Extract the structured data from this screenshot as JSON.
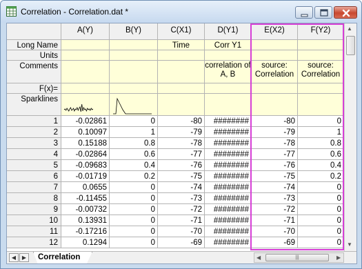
{
  "window": {
    "title": "Correlation - Correlation.dat *"
  },
  "columns": [
    {
      "header": "A(Y)",
      "long_name": "",
      "units": "",
      "comments": "",
      "fx": "",
      "sparkline": "noise"
    },
    {
      "header": "B(Y)",
      "long_name": "",
      "units": "",
      "comments": "",
      "fx": "",
      "sparkline": "decay"
    },
    {
      "header": "C(X1)",
      "long_name": "Time",
      "units": "",
      "comments": "",
      "fx": "",
      "sparkline": ""
    },
    {
      "header": "D(Y1)",
      "long_name": "Corr Y1",
      "units": "",
      "comments": "correlation of A, B",
      "fx": "",
      "sparkline": ""
    },
    {
      "header": "E(X2)",
      "long_name": "",
      "units": "",
      "comments": "source: Correlation",
      "fx": "",
      "sparkline": ""
    },
    {
      "header": "F(Y2)",
      "long_name": "",
      "units": "",
      "comments": "source: Correlation",
      "fx": "",
      "sparkline": ""
    }
  ],
  "row_labels": {
    "long_name": "Long Name",
    "units": "Units",
    "comments": "Comments",
    "fx": "F(x)=",
    "sparklines": "Sparklines"
  },
  "rows": [
    {
      "n": "1",
      "cells": [
        "-0.02861",
        "0",
        "-80",
        "########",
        "-80",
        "0"
      ]
    },
    {
      "n": "2",
      "cells": [
        "0.10097",
        "1",
        "-79",
        "########",
        "-79",
        "1"
      ]
    },
    {
      "n": "3",
      "cells": [
        "0.15188",
        "0.8",
        "-78",
        "########",
        "-78",
        "0.8"
      ]
    },
    {
      "n": "4",
      "cells": [
        "-0.02864",
        "0.6",
        "-77",
        "########",
        "-77",
        "0.6"
      ]
    },
    {
      "n": "5",
      "cells": [
        "-0.09683",
        "0.4",
        "-76",
        "########",
        "-76",
        "0.4"
      ]
    },
    {
      "n": "6",
      "cells": [
        "-0.01719",
        "0.2",
        "-75",
        "########",
        "-75",
        "0.2"
      ]
    },
    {
      "n": "7",
      "cells": [
        "0.0655",
        "0",
        "-74",
        "########",
        "-74",
        "0"
      ]
    },
    {
      "n": "8",
      "cells": [
        "-0.11455",
        "0",
        "-73",
        "########",
        "-73",
        "0"
      ]
    },
    {
      "n": "9",
      "cells": [
        "-0.00732",
        "0",
        "-72",
        "########",
        "-72",
        "0"
      ]
    },
    {
      "n": "10",
      "cells": [
        "0.13931",
        "0",
        "-71",
        "########",
        "-71",
        "0"
      ]
    },
    {
      "n": "11",
      "cells": [
        "-0.17216",
        "0",
        "-70",
        "########",
        "-70",
        "0"
      ]
    },
    {
      "n": "12",
      "cells": [
        "0.1294",
        "0",
        "-69",
        "########",
        "-69",
        "0"
      ]
    }
  ],
  "sheet_tab": {
    "label": "Correlation"
  },
  "selection": {
    "columns": [
      "E(X2)",
      "F(Y2)"
    ],
    "highlight_color": "#d63fd6"
  },
  "colors": {
    "meta_bg": "#ffffd9",
    "header_bg": "#f0f0f0",
    "grid_line": "#b3b3b3"
  },
  "icons": {
    "app": "worksheet-icon",
    "minimize": "minimize-icon",
    "maximize": "maximize-icon",
    "close": "close-icon",
    "scroll_up": "arrow-up-icon",
    "scroll_down": "arrow-down-icon",
    "scroll_left": "arrow-left-icon",
    "scroll_right": "arrow-right-icon",
    "grip": "scroll-grip-icon"
  }
}
